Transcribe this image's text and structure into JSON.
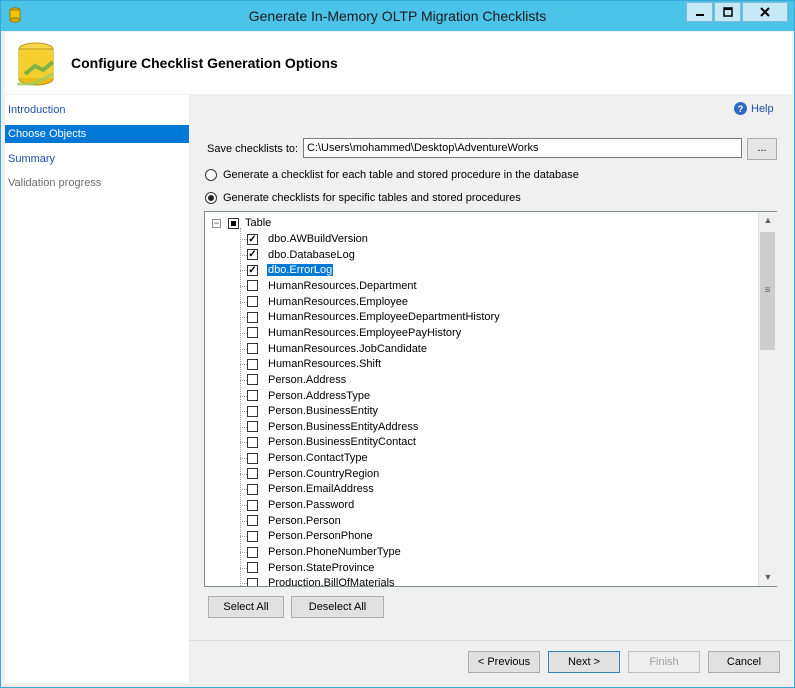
{
  "window": {
    "title": "Generate In-Memory OLTP Migration Checklists"
  },
  "header": {
    "title": "Configure Checklist Generation Options"
  },
  "nav": {
    "items": [
      {
        "label": "Introduction",
        "state": "link"
      },
      {
        "label": "Choose Objects",
        "state": "active"
      },
      {
        "label": "Summary",
        "state": "link"
      },
      {
        "label": "Validation progress",
        "state": "disabled"
      }
    ]
  },
  "help": {
    "label": "Help"
  },
  "save": {
    "label": "Save checklists to:",
    "value": "C:\\Users\\mohammed\\Desktop\\AdventureWorks",
    "browse_label": "..."
  },
  "options": {
    "all_label": "Generate a checklist for each table and stored procedure in the database",
    "specific_label": "Generate checklists for specific tables and stored procedures",
    "selected": "specific"
  },
  "tree": {
    "root_label": "Table",
    "items": [
      {
        "label": "dbo.AWBuildVersion",
        "checked": true
      },
      {
        "label": "dbo.DatabaseLog",
        "checked": true
      },
      {
        "label": "dbo.ErrorLog",
        "checked": true,
        "selected": true
      },
      {
        "label": "HumanResources.Department",
        "checked": false
      },
      {
        "label": "HumanResources.Employee",
        "checked": false
      },
      {
        "label": "HumanResources.EmployeeDepartmentHistory",
        "checked": false
      },
      {
        "label": "HumanResources.EmployeePayHistory",
        "checked": false
      },
      {
        "label": "HumanResources.JobCandidate",
        "checked": false
      },
      {
        "label": "HumanResources.Shift",
        "checked": false
      },
      {
        "label": "Person.Address",
        "checked": false
      },
      {
        "label": "Person.AddressType",
        "checked": false
      },
      {
        "label": "Person.BusinessEntity",
        "checked": false
      },
      {
        "label": "Person.BusinessEntityAddress",
        "checked": false
      },
      {
        "label": "Person.BusinessEntityContact",
        "checked": false
      },
      {
        "label": "Person.ContactType",
        "checked": false
      },
      {
        "label": "Person.CountryRegion",
        "checked": false
      },
      {
        "label": "Person.EmailAddress",
        "checked": false
      },
      {
        "label": "Person.Password",
        "checked": false
      },
      {
        "label": "Person.Person",
        "checked": false
      },
      {
        "label": "Person.PersonPhone",
        "checked": false
      },
      {
        "label": "Person.PhoneNumberType",
        "checked": false
      },
      {
        "label": "Person.StateProvince",
        "checked": false
      },
      {
        "label": "Production.BillOfMaterials",
        "checked": false
      }
    ]
  },
  "buttons": {
    "select_all": "Select All",
    "deselect_all": "Deselect All",
    "previous": "< Previous",
    "next": "Next >",
    "finish": "Finish",
    "cancel": "Cancel"
  },
  "colors": {
    "title_bar": "#4cc4ea",
    "selection": "#0078d7",
    "link": "#1f51a8"
  }
}
